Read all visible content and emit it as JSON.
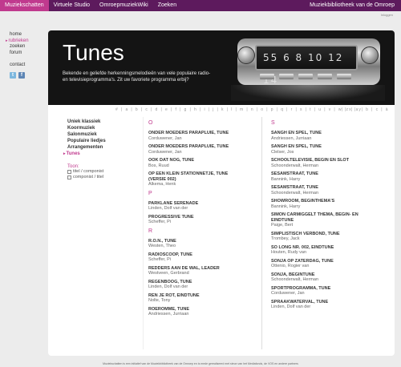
{
  "topbar": {
    "tabs": [
      {
        "label": "Muziekschatten",
        "active": true
      },
      {
        "label": "Virtuele Studio",
        "active": false
      },
      {
        "label": "OmroepmuziekWiki",
        "active": false
      },
      {
        "label": "Zoeken",
        "active": false
      }
    ],
    "brand": "Muziekbibliotheek van de Omroep",
    "login": "Inloggen"
  },
  "sidebar": {
    "items": [
      {
        "label": "home"
      },
      {
        "label": "rubrieken"
      },
      {
        "label": "zoeken"
      },
      {
        "label": "forum"
      },
      {
        "label": "contact"
      }
    ],
    "social": {
      "twitter": "t",
      "facebook": "f"
    }
  },
  "banner": {
    "title": "Tunes",
    "description": "Bekende en geliefde herkenningsmelodieën van vele populaire radio- en televisieprogramma's. Zit uw favoriete programma erbij?",
    "radio_display": "55 6 8 10 12 14"
  },
  "alphabet": {
    "left": "# | a | b | c | d | e | f | g | h | i | j | k | l | m | n | o | p | q | r | s | t | u | v | w | x | y",
    "right": "| z | a | b | c | ä"
  },
  "categories": {
    "items": [
      "Uniek klassiek",
      "Koormuziek",
      "Salonmuziek",
      "Populaire liedjes",
      "Arrangementen",
      "Tunes"
    ],
    "show_label": "Toon:",
    "options": [
      "titel / componist",
      "componist / titel"
    ]
  },
  "columns": [
    {
      "groups": [
        {
          "letter": "O",
          "items": [
            {
              "title": "ONDER MOEDERS PARAPLUIE, TUNE",
              "author": "Corduwener, Jan"
            },
            {
              "title": "ONDER MOEDERS PARAPLUIE, TUNE",
              "author": "Corduwener, Jan"
            },
            {
              "title": "OOK DAT NOG, TUNE",
              "author": "Bos, Ruud"
            },
            {
              "title": "OP EEN KLEIN STATIONNETJE, TUNE (VERSIE 002)",
              "author": "Alkema, Henk"
            }
          ]
        },
        {
          "letter": "P",
          "items": [
            {
              "title": "PARKLANE SERENADE",
              "author": "Linden, Dolf van der"
            },
            {
              "title": "PROGRESSIVE TUNE",
              "author": "Scheffer, Pi"
            }
          ]
        },
        {
          "letter": "R",
          "items": [
            {
              "title": "R.O.N., TUNE",
              "author": "Westen, Theo"
            },
            {
              "title": "RADIOSCOOP, TUNE",
              "author": "Scheffer, Pi"
            },
            {
              "title": "REDDERS AAN DE WAL, LEADER",
              "author": "Westveen, Gerbrand"
            },
            {
              "title": "REGENBOOG, TUNE",
              "author": "Linden, Dolf van der"
            },
            {
              "title": "REN JE ROT, EINDTUNE",
              "author": "Nolte, Tony"
            },
            {
              "title": "ROEROMME, TUNE",
              "author": "Andriessen, Jurriaan"
            }
          ]
        }
      ]
    },
    {
      "groups": [
        {
          "letter": "S",
          "items": [
            {
              "title": "SANGH EN SPEL, TUNE",
              "author": "Andriessen, Jurriaan"
            },
            {
              "title": "SANGH EN SPEL, TUNE",
              "author": "Clelser, Jos"
            },
            {
              "title": "SCHOOLTELEVISIE, BEGIN EN SLOT",
              "author": "Schoonderwalt, Herman"
            },
            {
              "title": "SESAMSTRAAT, TUNE",
              "author": "Bannink, Harry"
            },
            {
              "title": "SESAMSTRAAT, TUNE",
              "author": "Schoonderwalt, Herman"
            },
            {
              "title": "SHOWROOM, BEGINTHEMA'S",
              "author": "Bannink, Harry"
            },
            {
              "title": "SIMON CARMIGGELT THEMA, BEGIN- EN EINDTUNE",
              "author": "Paige, Bert"
            },
            {
              "title": "SIMPLISTISCH VERBOND, TUNE",
              "author": "Trombey, Jack"
            },
            {
              "title": "SO LONG NR. 002, EINDTUNE",
              "author": "Houten, Rudy van"
            },
            {
              "title": "SONJA OP ZATERDAG, TUNE",
              "author": "Ottenio, Rogier van"
            },
            {
              "title": "SONJA, BEGINTUNE",
              "author": "Schoonderwalt, Herman"
            },
            {
              "title": "SPORTPROGRAMMA, TUNE",
              "author": "Corduwener, Jan"
            },
            {
              "title": "SPRAAKWATERVAL, TUNE",
              "author": "Linden, Dolf van der"
            }
          ]
        }
      ]
    }
  ],
  "footer": "Muziekschatten is een initiatief van de Muziekbibliotheek van de Omroep en is mede gerealiseerd met steun van het Mediafonds, de VOS en andere partners"
}
